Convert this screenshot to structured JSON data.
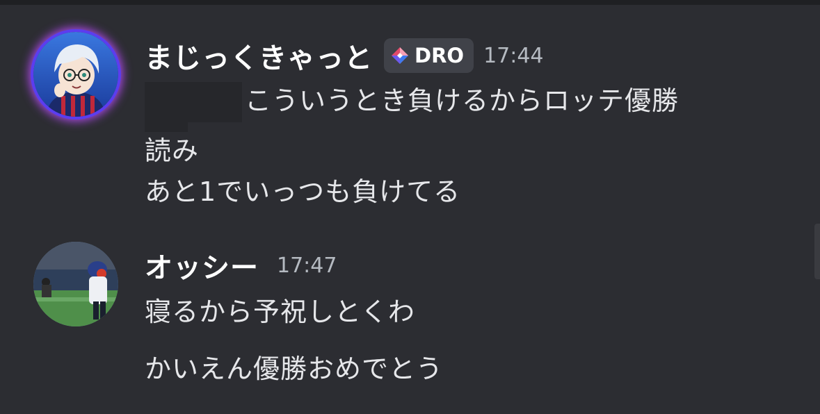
{
  "messages": [
    {
      "username": "まじっくきゃっと",
      "tag": "DRO",
      "time": "17:44",
      "lines": [
        "こういうとき負けるからロッテ優勝",
        "読み",
        "あと1でいっつも負けてる"
      ]
    },
    {
      "username": "オッシー",
      "time": "17:47",
      "lines": [
        "寝るから予祝しとくわ",
        "かいえん優勝おめでとう"
      ]
    }
  ],
  "colors": {
    "background": "#2c2d32",
    "text": "#e6e7ea",
    "timestamp": "#b5bac1",
    "tag_bg": "#404249"
  },
  "icons": {
    "tag_icon": "diamond-gem-icon"
  }
}
